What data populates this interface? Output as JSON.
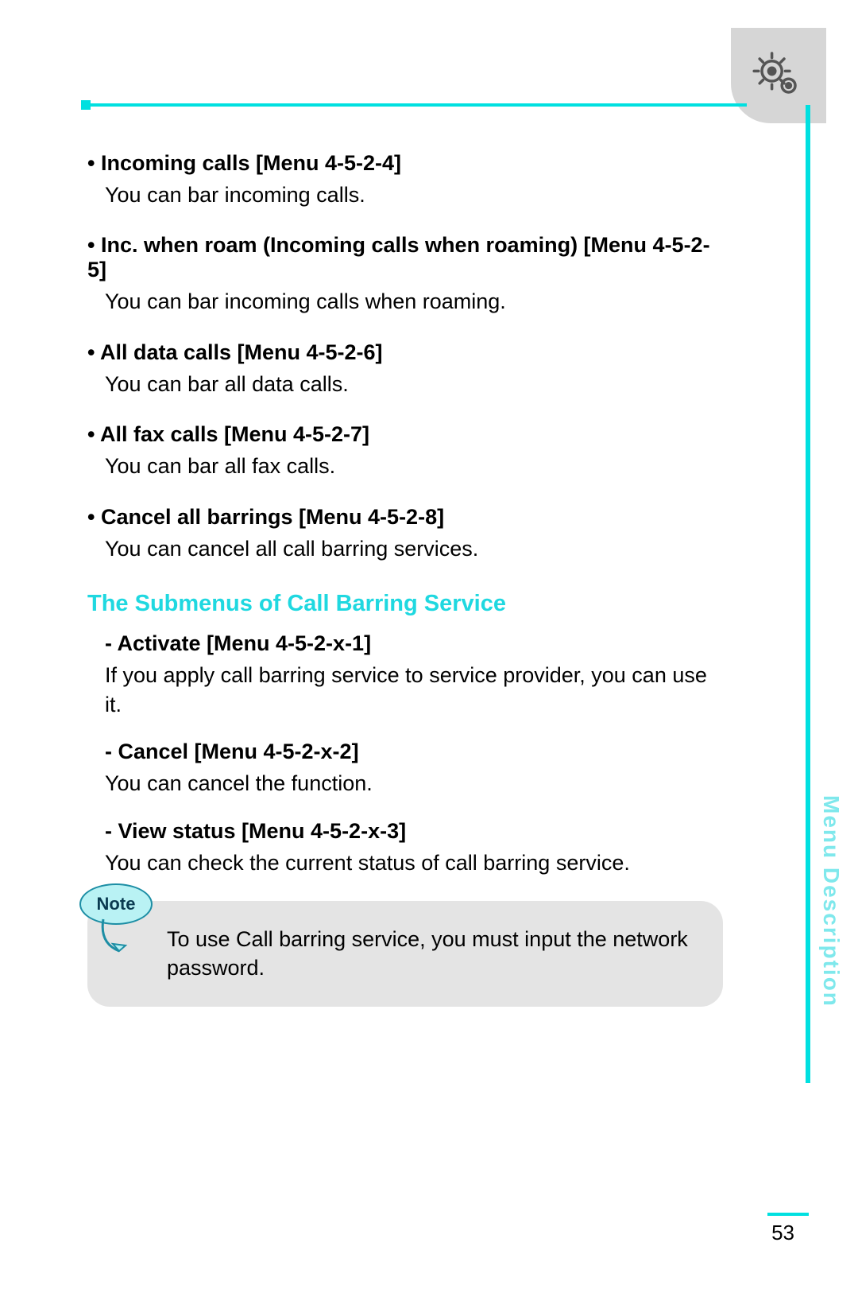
{
  "items": [
    {
      "title": "Incoming calls [Menu 4-5-2-4]",
      "desc": "You can bar incoming calls."
    },
    {
      "title": "Inc. when roam (Incoming calls when roaming) [Menu 4-5-2-5]",
      "desc": "You can bar incoming calls when roaming."
    },
    {
      "title": "All data calls [Menu 4-5-2-6]",
      "desc": "You can bar all data calls."
    },
    {
      "title": "All fax calls [Menu 4-5-2-7]",
      "desc": "You can bar all fax calls."
    },
    {
      "title": "Cancel all barrings [Menu 4-5-2-8]",
      "desc": "You can cancel all call barring services."
    }
  ],
  "subhead": "The Submenus of Call Barring Service",
  "subitems": [
    {
      "title": "- Activate [Menu 4-5-2-x-1]",
      "desc": "If you apply call barring service to service provider, you can use it."
    },
    {
      "title": "- Cancel [Menu 4-5-2-x-2]",
      "desc": "You can cancel the function."
    },
    {
      "title": "- View status [Menu 4-5-2-x-3]",
      "desc": "You can check the current status of call barring  service."
    }
  ],
  "note": {
    "label": "Note",
    "text": "To use Call barring service, you must input the network password."
  },
  "sideLabel": "Menu Description",
  "pageNumber": "53"
}
